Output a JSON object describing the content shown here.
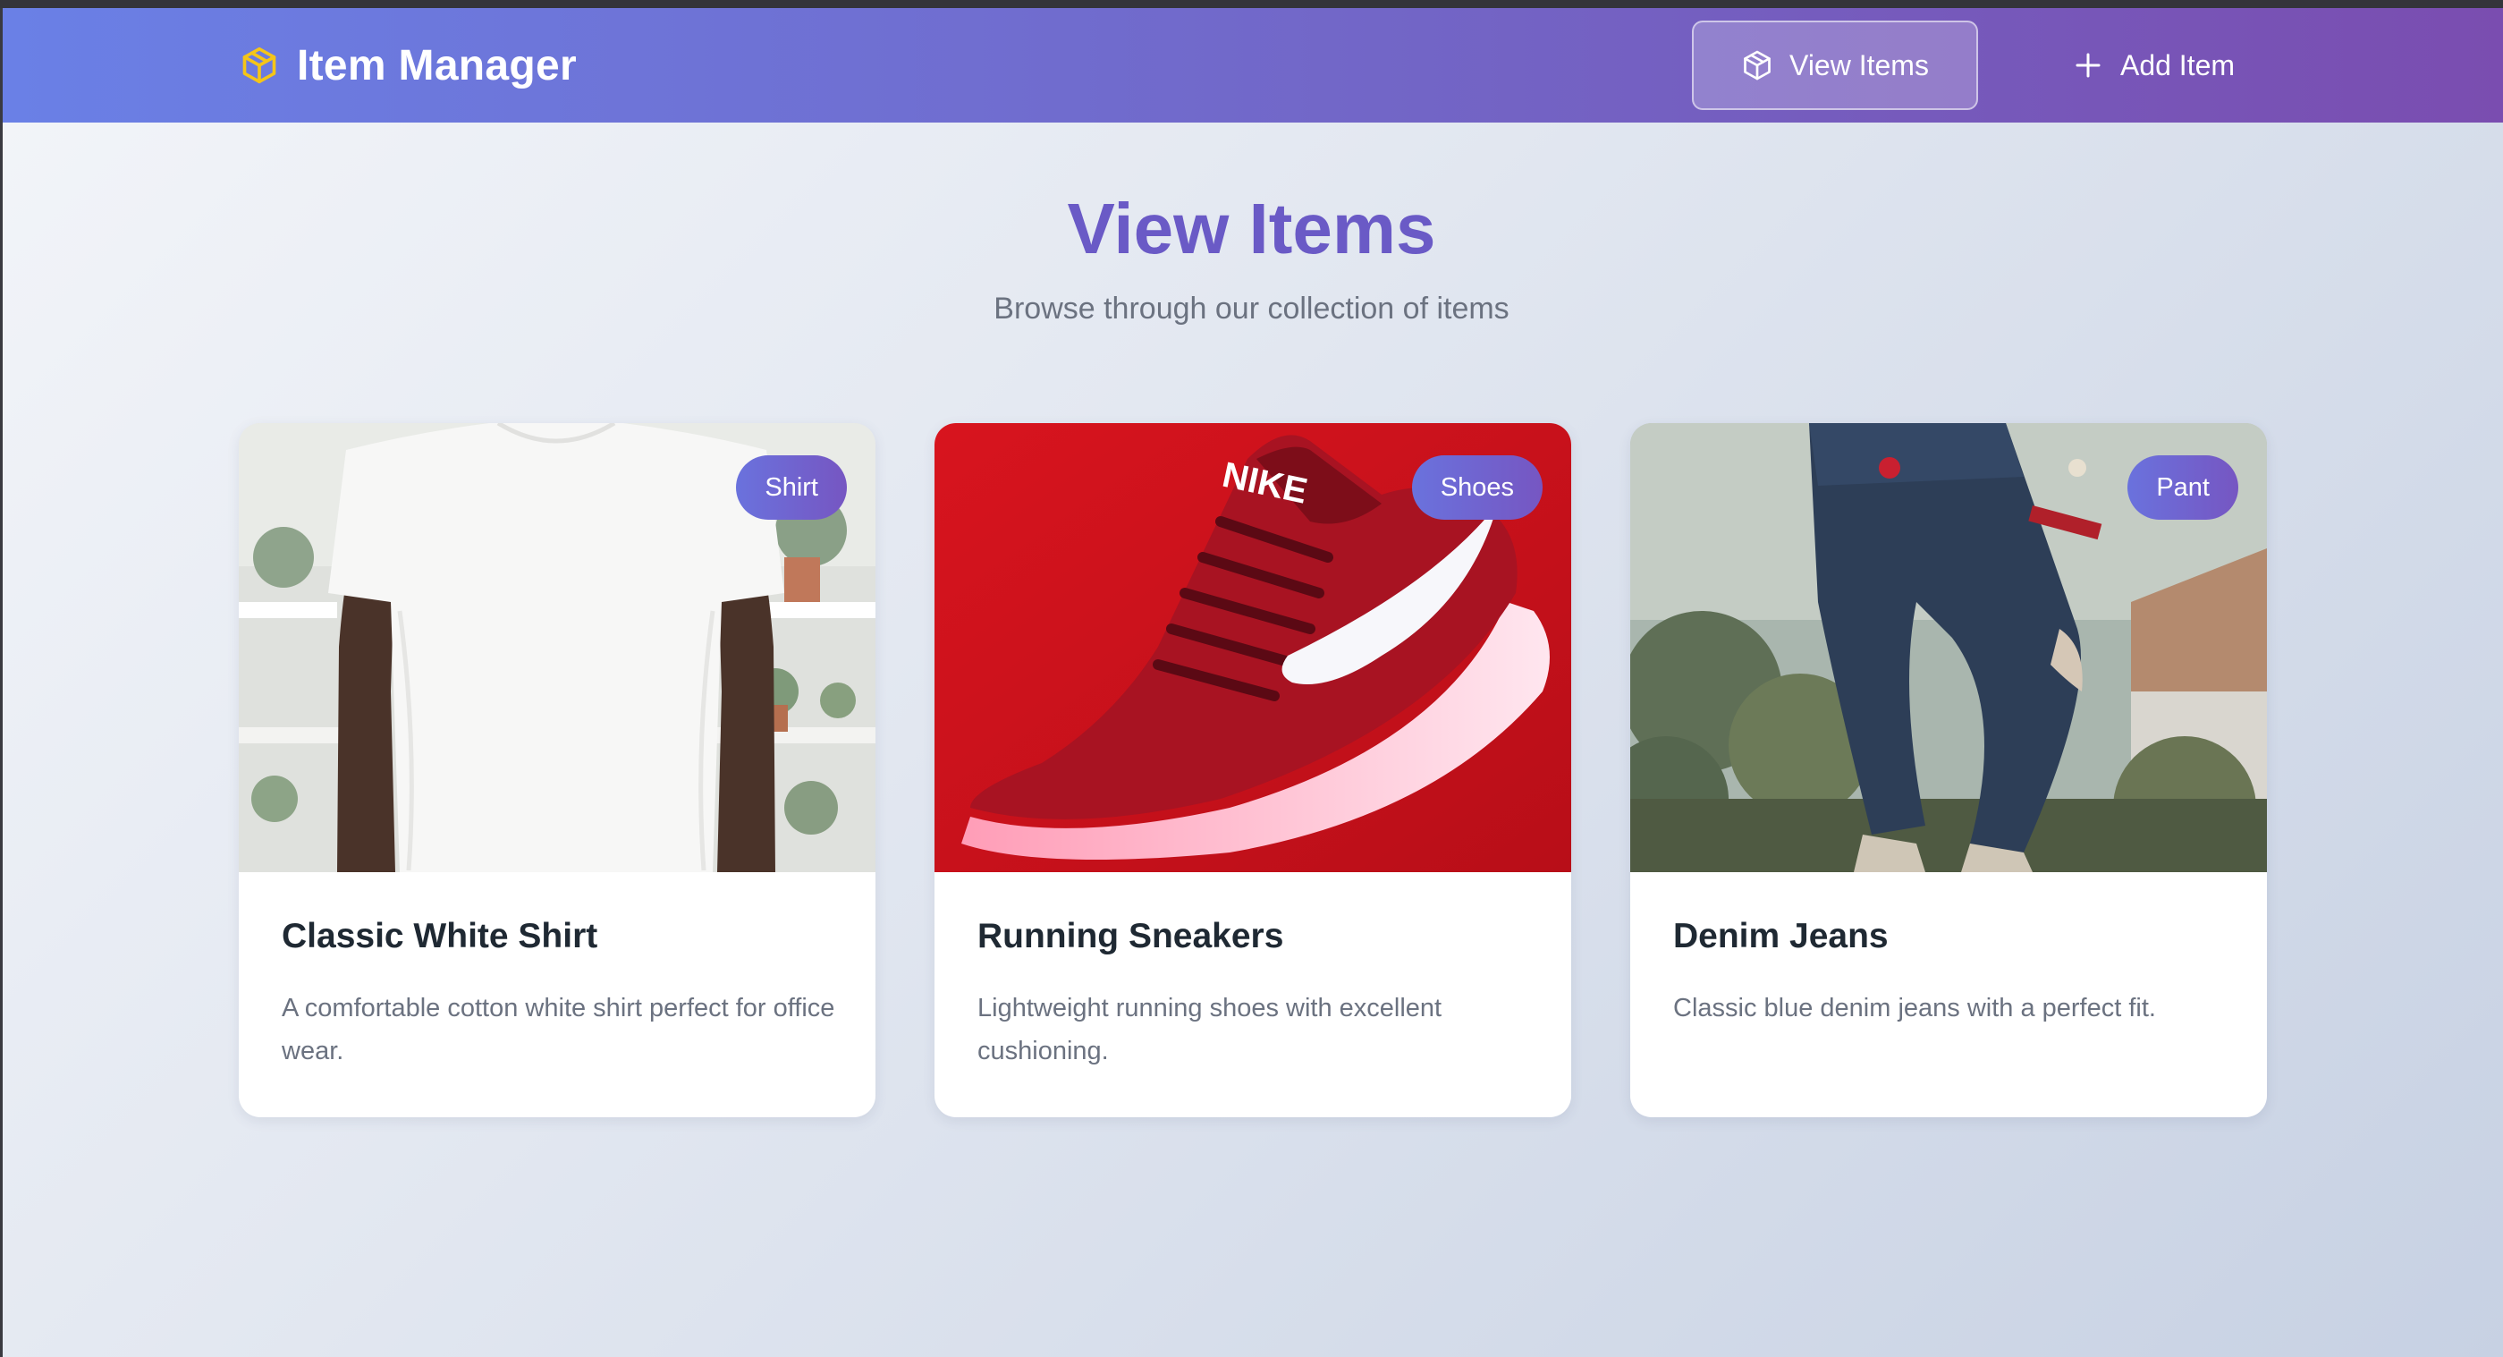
{
  "app": {
    "title": "Item Manager",
    "logo_icon": "cube-icon"
  },
  "nav": {
    "items": [
      {
        "label": "View Items",
        "icon": "cube-icon",
        "active": true
      },
      {
        "label": "Add Item",
        "icon": "plus-icon",
        "active": false
      }
    ]
  },
  "page": {
    "title": "View Items",
    "subtitle": "Browse through our collection of items"
  },
  "items": [
    {
      "badge": "Shirt",
      "title": "Classic White Shirt",
      "description": "A comfortable cotton white shirt perfect for office wear.",
      "image": "white-tshirt-photo"
    },
    {
      "badge": "Shoes",
      "title": "Running Sneakers",
      "description": "Lightweight running shoes with excellent cushioning.",
      "image": "red-nike-sneaker-photo"
    },
    {
      "badge": "Pant",
      "title": "Denim Jeans",
      "description": "Classic blue denim jeans with a perfect fit.",
      "image": "ripped-denim-jeans-photo"
    }
  ],
  "colors": {
    "nav_gradient_start": "#6a80e6",
    "nav_gradient_end": "#7a4db0",
    "accent": "#6a5ac6",
    "logo_icon_color": "#f5c518",
    "badge_gradient_start": "#6a72dd",
    "badge_gradient_end": "#7656c2"
  }
}
